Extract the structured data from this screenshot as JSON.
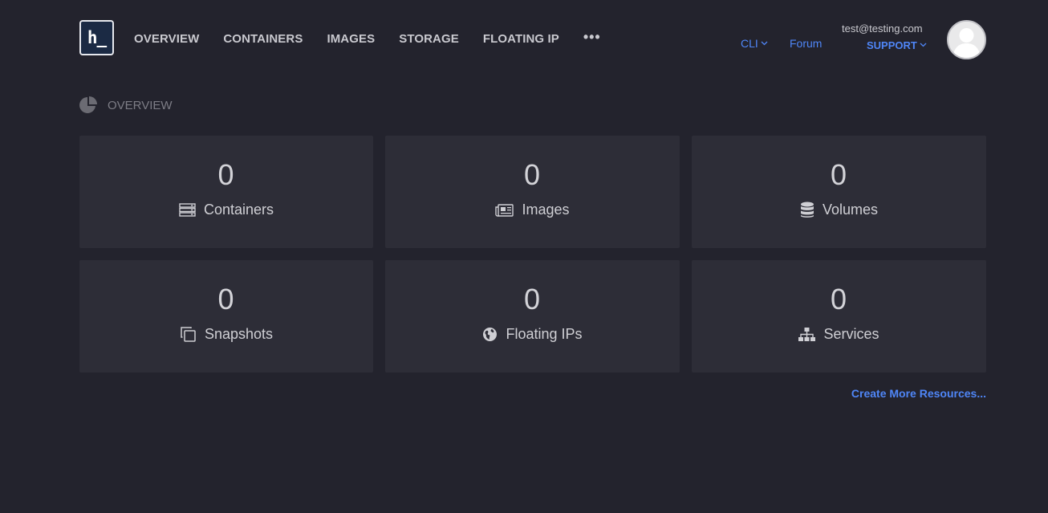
{
  "header": {
    "logo_text": "h_",
    "nav": [
      {
        "label": "OVERVIEW"
      },
      {
        "label": "CONTAINERS"
      },
      {
        "label": "IMAGES"
      },
      {
        "label": "STORAGE"
      },
      {
        "label": "FLOATING IP"
      },
      {
        "label": "•••"
      }
    ],
    "cli_label": "CLI",
    "forum_label": "Forum",
    "user_email": "test@testing.com",
    "support_label": "SUPPORT"
  },
  "section": {
    "title": "OVERVIEW",
    "icon": "pie-chart-icon"
  },
  "cards": [
    {
      "count": "0",
      "label": "Containers",
      "icon": "server-icon"
    },
    {
      "count": "0",
      "label": "Images",
      "icon": "newspaper-icon"
    },
    {
      "count": "0",
      "label": "Volumes",
      "icon": "database-icon"
    },
    {
      "count": "0",
      "label": "Snapshots",
      "icon": "copy-icon"
    },
    {
      "count": "0",
      "label": "Floating IPs",
      "icon": "globe-icon"
    },
    {
      "count": "0",
      "label": "Services",
      "icon": "sitemap-icon"
    }
  ],
  "create_more_label": "Create More Resources...",
  "colors": {
    "background": "#23232d",
    "card": "#2d2d37",
    "link": "#4f86f7",
    "text": "#cfcfd4"
  }
}
